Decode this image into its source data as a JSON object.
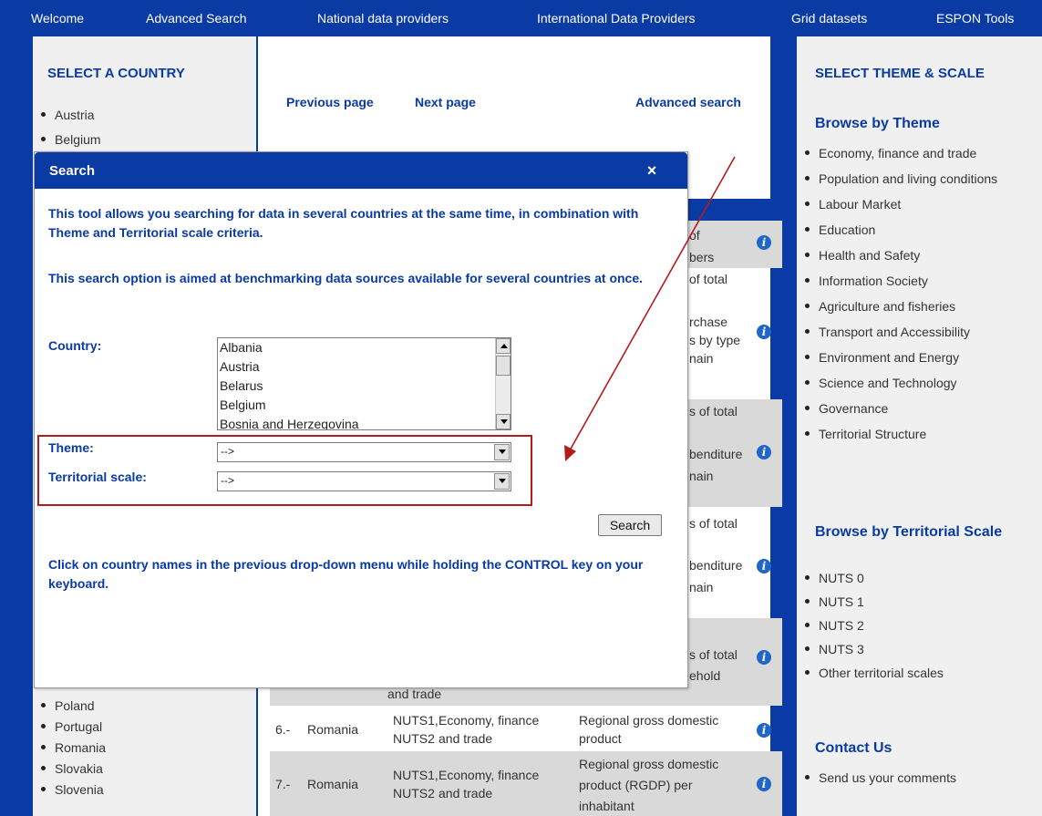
{
  "nav": {
    "welcome": "Welcome",
    "advanced_search": "Advanced Search",
    "national": "National data providers",
    "international": "International Data Providers",
    "grid": "Grid datasets",
    "espon": "ESPON Tools"
  },
  "left": {
    "heading": "SELECT A COUNTRY",
    "top_countries": [
      "Austria",
      "Belgium"
    ],
    "bottom_countries": [
      "Poland",
      "Portugal",
      "Romania",
      "Slovakia",
      "Slovenia"
    ]
  },
  "main": {
    "previous_page": "Previous page",
    "next_page": "Next page",
    "advanced_search": "Advanced search",
    "fragments": {
      "f1": "of",
      "f2": "bers",
      "f3": "of total",
      "f4": "rchase",
      "f5": "s by type",
      "f6": "nain",
      "f7": "s of total",
      "f8": "benditure",
      "f9": "nain",
      "f10": "s of total",
      "f11": "benditure",
      "f12": "nain",
      "f13": "s of total",
      "f14": "ehold",
      "f15": "and trade"
    },
    "rows": [
      {
        "num": "6.-",
        "country": "Romania",
        "scale1": "NUTS1,",
        "scale2": "NUTS2",
        "theme1": "Economy, finance",
        "theme2": "and trade",
        "title": [
          "Regional gross domestic",
          "product"
        ]
      },
      {
        "num": "7.-",
        "country": "Romania",
        "scale1": "NUTS1,",
        "scale2": "NUTS2",
        "theme1": "Economy, finance",
        "theme2": "and trade",
        "title": [
          "Regional gross domestic",
          "product (RGDP) per",
          "inhabitant"
        ]
      }
    ]
  },
  "right": {
    "heading": "SELECT THEME & SCALE",
    "browse_theme": "Browse by Theme",
    "themes": [
      "Economy, finance and trade",
      "Population and living conditions",
      "Labour Market",
      "Education",
      "Health and Safety",
      "Information Society",
      "Agriculture and fisheries",
      "Transport and Accessibility",
      "Environment and Energy",
      "Science and Technology",
      "Governance",
      "Territorial Structure"
    ],
    "browse_scale": "Browse by Territorial Scale",
    "scales": [
      "NUTS 0",
      "NUTS 1",
      "NUTS 2",
      "NUTS 3",
      "Other territorial scales"
    ],
    "contact": "Contact Us",
    "contact_items": [
      "Send us your comments"
    ]
  },
  "modal": {
    "title": "Search",
    "close": "×",
    "intro1": "This tool allows you searching for data in several countries at the same time, in combination with Theme and Territorial scale criteria.",
    "intro2": "This search option is aimed at benchmarking data sources available for several countries at once.",
    "country_label": "Country:",
    "countries": [
      "Albania",
      "Austria",
      "Belarus",
      "Belgium",
      "Bosnia and Herzegovina"
    ],
    "theme_label": "Theme:",
    "theme_value": "-->",
    "scale_label": "Territorial scale:",
    "scale_value": "-->",
    "search_button": "Search",
    "hint": "Click on country names in the previous drop-down menu while holding the CONTROL key on your keyboard."
  },
  "colors": {
    "brand": "#0a3aa4",
    "highlight": "#b41c1c"
  }
}
